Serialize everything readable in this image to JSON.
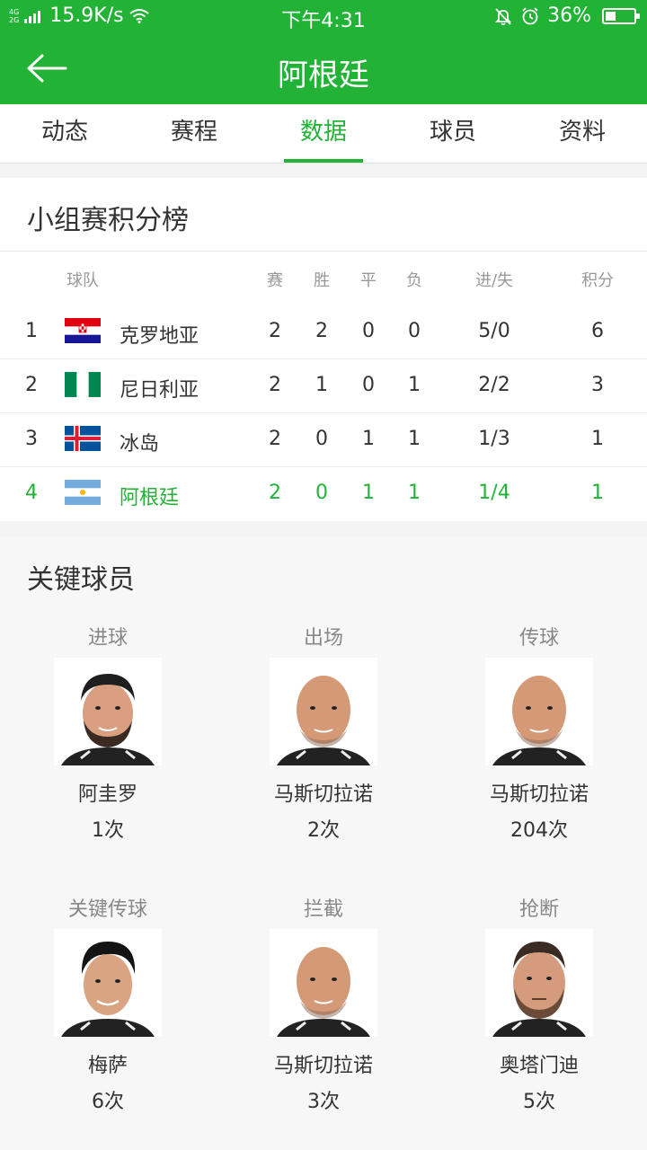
{
  "status": {
    "net_top": "4G",
    "net_bottom": "2G",
    "speed": "15.9K/s",
    "time": "下午4:31",
    "battery": "36%",
    "battery_level": 0.36
  },
  "header": {
    "title": "阿根廷"
  },
  "tabs": [
    {
      "label": "动态"
    },
    {
      "label": "赛程"
    },
    {
      "label": "数据"
    },
    {
      "label": "球员"
    },
    {
      "label": "资料"
    }
  ],
  "active_tab": "数据",
  "standings": {
    "title": "小组赛积分榜",
    "columns": {
      "team": "球队",
      "played": "赛",
      "won": "胜",
      "draw": "平",
      "lost": "负",
      "goals": "进/失",
      "points": "积分"
    },
    "rows": [
      {
        "rank": "1",
        "team": "克罗地亚",
        "flag": "croatia",
        "played": "2",
        "won": "2",
        "draw": "0",
        "lost": "0",
        "goals": "5/0",
        "points": "6"
      },
      {
        "rank": "2",
        "team": "尼日利亚",
        "flag": "nigeria",
        "played": "2",
        "won": "1",
        "draw": "0",
        "lost": "1",
        "goals": "2/2",
        "points": "3"
      },
      {
        "rank": "3",
        "team": "冰岛",
        "flag": "iceland",
        "played": "2",
        "won": "0",
        "draw": "1",
        "lost": "1",
        "goals": "1/3",
        "points": "1"
      },
      {
        "rank": "4",
        "team": "阿根廷",
        "flag": "argentina",
        "played": "2",
        "won": "0",
        "draw": "1",
        "lost": "1",
        "goals": "1/4",
        "points": "1"
      }
    ],
    "highlight_color": "#21b236"
  },
  "key_players": {
    "title": "关键球员",
    "items": [
      {
        "category": "进球",
        "name": "阿圭罗",
        "count": "1次",
        "photo": "bearded-player-photo"
      },
      {
        "category": "出场",
        "name": "马斯切拉诺",
        "count": "2次",
        "photo": "bald-player-photo"
      },
      {
        "category": "传球",
        "name": "马斯切拉诺",
        "count": "204次",
        "photo": "bald-player-photo"
      },
      {
        "category": "关键传球",
        "name": "梅萨",
        "count": "6次",
        "photo": "young-player-photo"
      },
      {
        "category": "拦截",
        "name": "马斯切拉诺",
        "count": "3次",
        "photo": "bald-player-photo"
      },
      {
        "category": "抢断",
        "name": "奥塔门迪",
        "count": "5次",
        "photo": "bearded-player-photo"
      }
    ]
  },
  "colors": {
    "brand": "#21b236",
    "background": "#f4f4f4"
  }
}
